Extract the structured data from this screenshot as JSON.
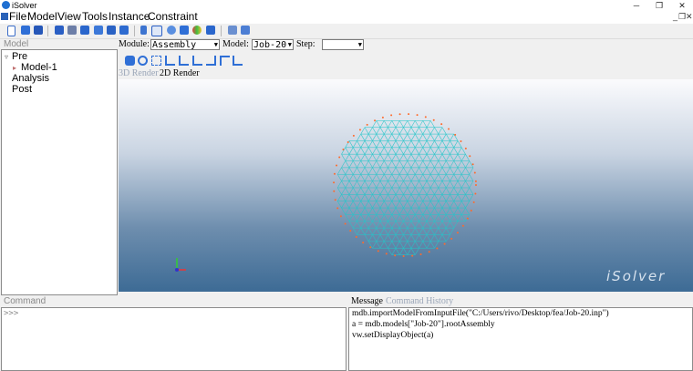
{
  "window": {
    "title": "iSolver"
  },
  "menu": [
    "File",
    "Model",
    "View",
    "Tools",
    "Instance",
    "Constraint"
  ],
  "toolbar_icons": [
    "new-file-icon",
    "open-folder-icon",
    "save-icon",
    "cube-icon",
    "box-icon",
    "part-icon",
    "section-icon",
    "mesh-icon",
    "assembly-icon",
    "sphere-icon",
    "load-icon",
    "step-icon",
    "job-icon",
    "list-icon",
    "render-mode-icon",
    "shade-icon",
    "copy-icon",
    "cloud-icon",
    "data-icon",
    "import-icon",
    "export-icon"
  ],
  "panels": {
    "model_header": "Model",
    "command_header": "Command",
    "message_tab": "Message",
    "history_tab": "Command History"
  },
  "tree": {
    "pre": "Pre",
    "model": "Model-1",
    "analysis": "Analysis",
    "post": "Post"
  },
  "selectors": {
    "module_label": "Module:",
    "module_value": "Assembly",
    "model_label": "Model:",
    "model_value": "Job-20",
    "step_label": "Step:",
    "step_value": ""
  },
  "render_tabs": {
    "three_d": "3D Render",
    "two_d": "2D Render"
  },
  "viewport": {
    "watermark": "iSolver",
    "mesh_color": "#24c6c9",
    "node_color": "#ff6a2a"
  },
  "command": {
    "prompt": ">>>"
  },
  "messages": [
    "mdb.importModelFromInputFile(\"C:/Users/rivo/Desktop/fea/Job-20.inp\")",
    "a = mdb.models[\"Job-20\"].rootAssembly",
    "vw.setDisplayObject(a)"
  ]
}
